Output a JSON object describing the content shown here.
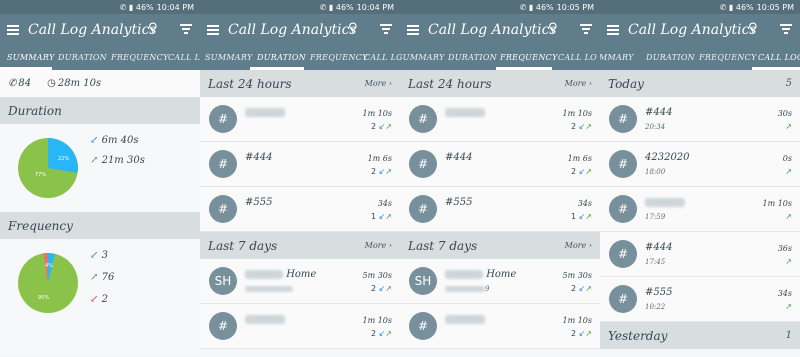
{
  "status": {
    "signal": "✆ ▮ 46%",
    "times": [
      "10:04 PM",
      "10:04 PM",
      "10:05 PM",
      "10:05 PM"
    ]
  },
  "app": {
    "title": "Call Log Analytics"
  },
  "tabs": {
    "p1": [
      "SUMMARY",
      "DURATION",
      "FREQUENCY",
      "CALL LO"
    ],
    "p2": [
      "SUMMARY",
      "DURATION",
      "FREQUENCY",
      "CALL LOG"
    ],
    "p3": [
      "SUMMARY",
      "DURATION",
      "FREQUENCY",
      "CALL LO"
    ],
    "p4": [
      "MMARY",
      "DURATION",
      "FREQUENCY",
      "CALL LOG"
    ]
  },
  "summary": {
    "total_calls": "84",
    "total_duration": "28m 10s",
    "duration_label": "Duration",
    "frequency_label": "Frequency",
    "duration_chart": {
      "pct_incoming": "22%",
      "pct_outgoing": "77%",
      "incoming": "6m 40s",
      "outgoing": "21m 30s",
      "fractions": [
        0.225,
        0.775
      ]
    },
    "frequency_chart": {
      "pct_other": "4%",
      "pct_outgoing": "95%",
      "incoming": "3",
      "outgoing": "76",
      "missed": "2",
      "fractions": [
        0.037,
        0.025,
        0.938
      ]
    },
    "colors": {
      "incoming": "#29b6f6",
      "outgoing": "#8bc34a",
      "missed": "#e57373"
    }
  },
  "duration_panel": {
    "last24": "Last 24 hours",
    "last7": "Last 7 days",
    "more": "More",
    "rows24": [
      {
        "avatar": "#",
        "name": "",
        "blurred": true,
        "dur": "1m 10s",
        "count": "2"
      },
      {
        "avatar": "#",
        "name": "#444",
        "blurred": false,
        "dur": "1m 6s",
        "count": "2"
      },
      {
        "avatar": "#",
        "name": "#555",
        "blurred": false,
        "dur": "34s",
        "count": "1"
      }
    ],
    "rows7": [
      {
        "avatar": "SH",
        "name": "Home",
        "blurred": true,
        "dur": "5m 30s",
        "count": "2"
      },
      {
        "avatar": "#",
        "name": "",
        "blurred": true,
        "dur": "1m 10s",
        "count": "2"
      }
    ]
  },
  "frequency_panel": {
    "last24": "Last 24 hours",
    "last7": "Last 7 days",
    "more": "More",
    "rows24": [
      {
        "avatar": "#",
        "name": "",
        "blurred": true,
        "dur": "1m 10s",
        "count": "2"
      },
      {
        "avatar": "#",
        "name": "#444",
        "blurred": false,
        "dur": "1m 6s",
        "count": "2"
      },
      {
        "avatar": "#",
        "name": "#555",
        "blurred": false,
        "dur": "34s",
        "count": "1"
      }
    ],
    "rows7": [
      {
        "avatar": "SH",
        "name": "Home",
        "sub": "9",
        "blurred": true,
        "dur": "5m 30s",
        "count": "2"
      },
      {
        "avatar": "#",
        "name": "",
        "blurred": true,
        "dur": "1m 10s",
        "count": "2"
      }
    ]
  },
  "calllog_panel": {
    "today": "Today",
    "today_count": "5",
    "yesterday": "Yesterday",
    "yesterday_count": "1",
    "rows": [
      {
        "avatar": "#",
        "name": "#444",
        "time": "20:34",
        "dur": "30s",
        "blurred": false
      },
      {
        "avatar": "#",
        "name": "4232020",
        "time": "18:00",
        "dur": "0s",
        "blurred": false
      },
      {
        "avatar": "#",
        "name": "",
        "time": "17:59",
        "dur": "1m 10s",
        "blurred": true
      },
      {
        "avatar": "#",
        "name": "#444",
        "time": "17:45",
        "dur": "36s",
        "blurred": false
      },
      {
        "avatar": "#",
        "name": "#555",
        "time": "10:22",
        "dur": "34s",
        "blurred": false
      }
    ]
  }
}
